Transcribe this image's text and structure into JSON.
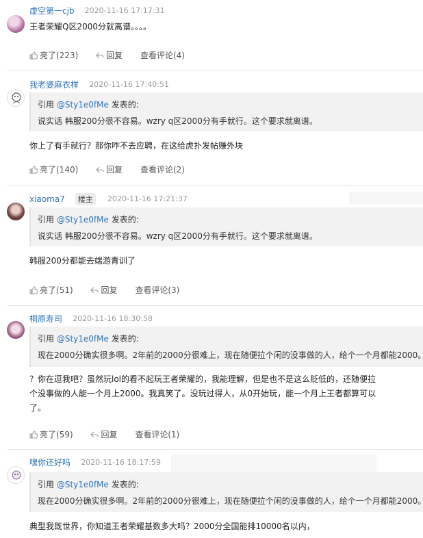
{
  "comments": [
    {
      "username": "虚空第一cjb",
      "badge": "",
      "time": "2020-11-16 17:17:31",
      "quote": null,
      "text": "王者荣耀Q区2000分就离谱。。。。",
      "likes": "亮了(223)",
      "reply": "回复",
      "view": "查看评论(4)"
    },
    {
      "username": "我老婆麻衣样",
      "badge": "",
      "time": "2020-11-16 17:40:51",
      "quote": {
        "prefix": "引用 ",
        "mention": "@Sty1e0fMe",
        "suffix": " 发表的:",
        "body": "说实话 韩服200分很不容易。wzry q区2000分有手就行。这个要求就离谱。"
      },
      "text": "你上了有手就行？那你咋不去应聘，在这给虎扑发帖赚外块",
      "likes": "亮了(140)",
      "reply": "回复",
      "view": "查看评论(2)"
    },
    {
      "username": "xiaoma7",
      "badge": "楼主",
      "time": "2020-11-16 17:21:37",
      "quote": {
        "prefix": "引用 ",
        "mention": "@Sty1e0fMe",
        "suffix": " 发表的:",
        "body": "说实话 韩服200分很不容易。wzry q区2000分有手就行。这个要求就离谱。"
      },
      "text": "韩服200分都能去端游青训了",
      "likes": "亮了(51)",
      "reply": "回复",
      "view": "查看评论(3)"
    },
    {
      "username": "桐原寿司",
      "badge": "",
      "time": "2020-11-16 18:30:58",
      "quote": {
        "prefix": "引用 ",
        "mention": "@Sty1e0fMe",
        "suffix": " 发表的:",
        "body": "现在2000分确实很多啊。2年前的2000分很难上，现在随便拉个闲的没事做的人，给个一个月都能2000。"
      },
      "text_lines": [
        "？你在逗我吧？虽然玩lol的看不起玩王者荣耀的，我能理解，但是也不是这么贬低的，还随便拉",
        "个没事做的人能一个月上2000。我真笑了。没玩过得人，从0开始玩，能一个月上王者都算可以",
        "了。"
      ],
      "likes": "亮了(59)",
      "reply": "回复",
      "view": "查看评论(1)"
    },
    {
      "username": "嘿你还好吗",
      "badge": "",
      "time": "2020-11-16 18:17:59",
      "quote": {
        "prefix": "引用 ",
        "mention": "@Sty1e0fMe",
        "suffix": " 发表的:",
        "body": "现在2000分确实很多啊。2年前的2000分很难上，现在随便拉个闲的没事做的人，给个一个月都能2000。"
      },
      "text": "典型我既世界，你知道王者荣耀基数多大吗？2000分全国能排10000名以内，"
    }
  ],
  "colors": {
    "link": "#2e74b8",
    "time": "#999999",
    "quote_bg": "#f2f2f2"
  }
}
